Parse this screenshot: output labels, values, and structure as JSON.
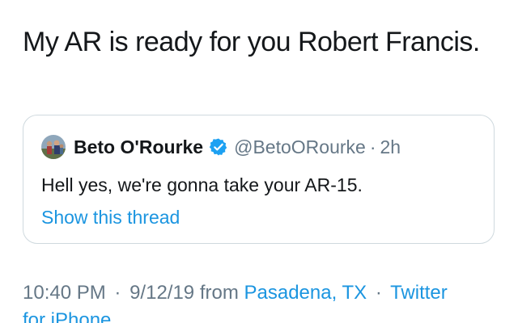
{
  "tweet": {
    "text": "My AR is ready for you Robert Francis."
  },
  "quoted_tweet": {
    "author_name": "Beto O'Rourke",
    "handle": "@BetoORourke",
    "separator": "·",
    "time_ago": "2h",
    "text": "Hell yes, we're gonna take your AR-15.",
    "show_thread_label": "Show this thread",
    "verified_icon": "verified-badge-icon",
    "accent_color": "#1b95e0"
  },
  "meta": {
    "time": "10:40 PM",
    "sep1": "·",
    "date": "9/12/19",
    "from_label": "from",
    "location": "Pasadena, TX",
    "sep2": "·",
    "source_part1": "Twitter",
    "source_part2": "for iPhone"
  },
  "colors": {
    "text": "#14171a",
    "secondary": "#657786",
    "link": "#1b95e0",
    "border": "#cfd9de"
  }
}
